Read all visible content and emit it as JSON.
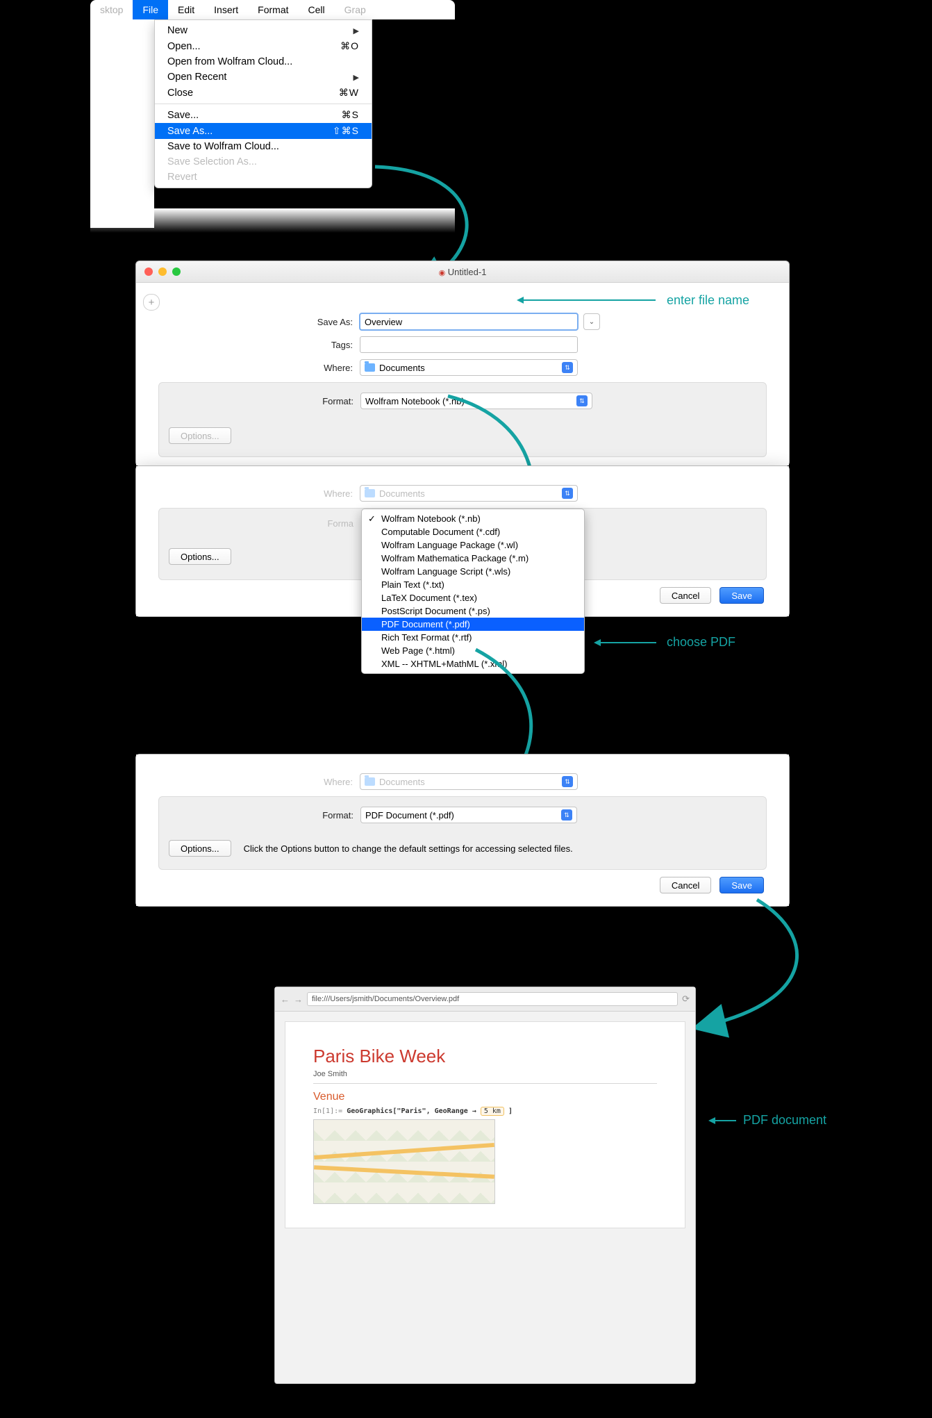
{
  "menubar": {
    "items": [
      "sktop",
      "File",
      "Edit",
      "Insert",
      "Format",
      "Cell",
      "Grap"
    ],
    "selected": 1
  },
  "filemenu": {
    "groups": [
      [
        {
          "label": "New",
          "sc": "",
          "sub": true
        },
        {
          "label": "Open...",
          "sc": "⌘O"
        },
        {
          "label": "Open from Wolfram Cloud..."
        },
        {
          "label": "Open Recent",
          "sub": true
        },
        {
          "label": "Close",
          "sc": "⌘W"
        }
      ],
      [
        {
          "label": "Save...",
          "sc": "⌘S"
        },
        {
          "label": "Save As...",
          "sc": "⇧⌘S",
          "hl": true
        },
        {
          "label": "Save to Wolfram Cloud..."
        },
        {
          "label": "Save Selection As...",
          "dis": true
        },
        {
          "label": "Revert",
          "dis": true
        }
      ]
    ]
  },
  "dialog1": {
    "title": "Untitled-1",
    "saveas_label": "Save As:",
    "saveas_value": "Overview",
    "tags_label": "Tags:",
    "tags_value": "",
    "where_label": "Where:",
    "where_value": "Documents",
    "format_label": "Format:",
    "format_value": "Wolfram Notebook (*.nb)",
    "options": "Options..."
  },
  "anno1": "enter file name",
  "dialog2": {
    "where_label": "Where:",
    "where_value": "Documents",
    "format_label": "Forma",
    "options": "Options...",
    "cancel": "Cancel",
    "save": "Save",
    "formats": [
      "Wolfram Notebook (*.nb)",
      "Computable Document (*.cdf)",
      "Wolfram Language Package (*.wl)",
      "Wolfram Mathematica Package (*.m)",
      "Wolfram Language Script (*.wls)",
      "Plain Text (*.txt)",
      "LaTeX Document (*.tex)",
      "PostScript Document (*.ps)",
      "PDF Document (*.pdf)",
      "Rich Text Format (*.rtf)",
      "Web Page (*.html)",
      "XML -- XHTML+MathML (*.xml)"
    ],
    "formats_checked": 0,
    "formats_hl": 8
  },
  "anno2": "choose PDF",
  "dialog3": {
    "where_label": "Where:",
    "where_value": "Documents",
    "format_label": "Format:",
    "format_value": "PDF Document (*.pdf)",
    "options": "Options...",
    "hint": "Click the Options button to change the default settings for accessing selected files.",
    "cancel": "Cancel",
    "save": "Save"
  },
  "browser": {
    "url": "file:///Users/jsmith/Documents/Overview.pdf",
    "title": "Paris Bike Week",
    "author": "Joe Smith",
    "section": "Venue",
    "code_label": "In[1]:=",
    "code": "GeoGraphics[\"Paris\", GeoRange → ",
    "code_qty": "5 km",
    "code_tail": "]"
  },
  "anno3": "PDF document"
}
